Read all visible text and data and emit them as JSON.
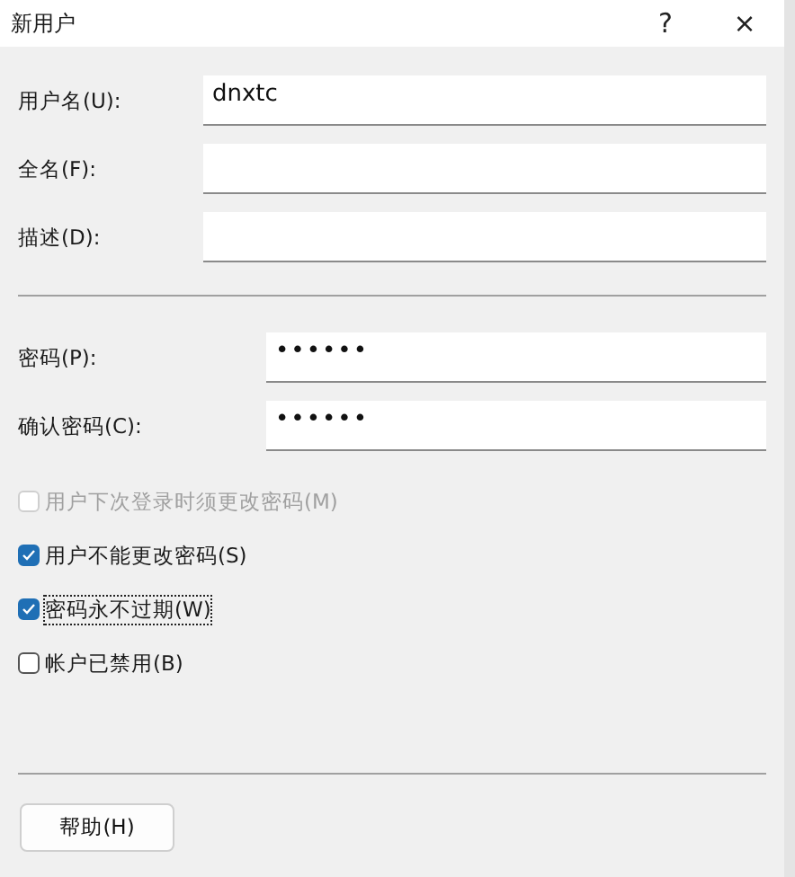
{
  "window": {
    "title": "新用户",
    "help": "?",
    "close": "×"
  },
  "fields": [
    {
      "label": "用户名(U):",
      "value": "dnxtc"
    },
    {
      "label": "全名(F):"
    },
    {
      "label": "描述(D):"
    }
  ],
  "password_fields": [
    {
      "label": "密码(P):",
      "value": "••••••"
    },
    {
      "label": "确认密码(C):",
      "value": "••••••"
    }
  ],
  "options": [
    {
      "label": "用户下次登录时须更改密码(M)",
      "checked": false,
      "disabled": true,
      "focused": false
    },
    {
      "label": "用户不能更改密码(S)",
      "checked": true,
      "disabled": false,
      "focused": false
    },
    {
      "label": "密码永不过期(W)",
      "checked": true,
      "disabled": false,
      "focused": true
    },
    {
      "label": "帐户已禁用(B)",
      "checked": false,
      "disabled": false,
      "focused": false
    }
  ],
  "buttons": [
    "帮助(H)"
  ]
}
